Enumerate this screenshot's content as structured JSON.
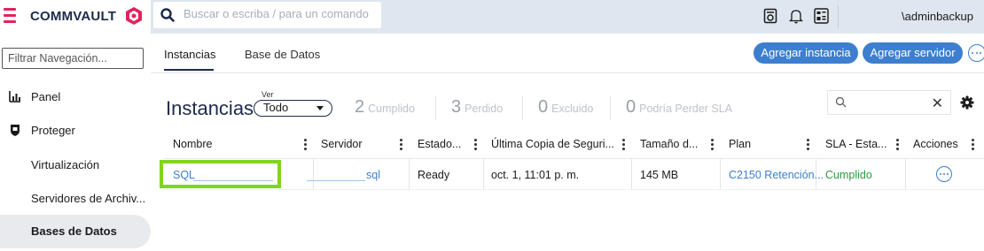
{
  "app": {
    "brand": "COMMVAULT",
    "brand_color": "#1c2b4d",
    "accent": "#e0245e"
  },
  "topbar": {
    "search_placeholder": "Buscar o escriba / para un comando",
    "icons": [
      "report-icon",
      "bell-icon",
      "dashboard-icon"
    ],
    "user": "\\adminbackup"
  },
  "sidebar": {
    "filter_placeholder": "Filtrar Navegación...",
    "items": [
      {
        "label": "Panel",
        "icon": "chart-icon"
      },
      {
        "label": "Proteger",
        "icon": "shield-icon"
      },
      {
        "label": "Virtualización"
      },
      {
        "label": "Servidores de Archiv..."
      },
      {
        "label": "Bases de Datos",
        "active": true
      }
    ]
  },
  "tabs": [
    "Instancias",
    "Base de Datos"
  ],
  "actions": {
    "add_instance": "Agregar instancia",
    "add_server": "Agregar servidor"
  },
  "page": {
    "title": "Instancias",
    "view_label": "Ver",
    "view_value": "Todo",
    "stats": [
      {
        "num": "2",
        "label": "Cumplido"
      },
      {
        "num": "3",
        "label": "Perdido"
      },
      {
        "num": "0",
        "label": "Excluido"
      },
      {
        "num": "0",
        "label": "Podría Perder SLA"
      }
    ]
  },
  "table": {
    "columns": [
      "Nombre",
      "Servidor",
      "Estado...",
      "Última Copia de Seguri...",
      "Tamaño d...",
      "Plan",
      "SLA - Esta...",
      "Acciones"
    ],
    "rows": [
      {
        "name": "SQL",
        "server": "sql",
        "status": "Ready",
        "last_backup": "oct. 1, 11:01 p. m.",
        "size": "145 MB",
        "plan": "C2150 Retención...",
        "sla": "Cumplido"
      }
    ]
  },
  "colors": {
    "link": "#3d7fce",
    "success": "#2e9a3c",
    "highlight": "#7fd51f"
  }
}
